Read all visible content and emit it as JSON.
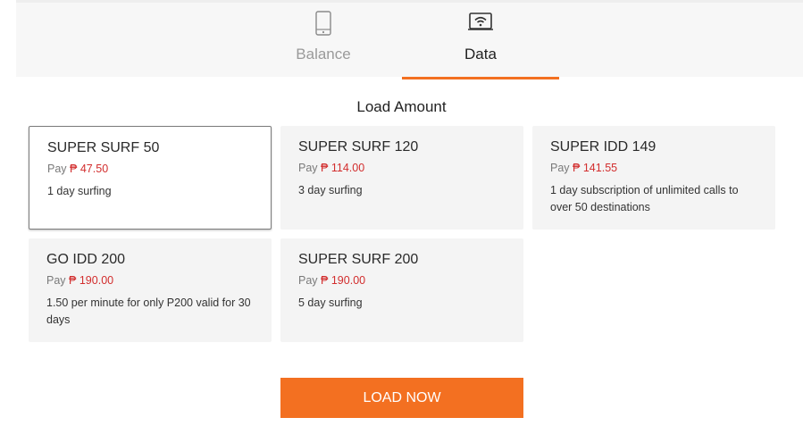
{
  "tabs": [
    {
      "label": "Balance",
      "icon": "mobile-phone-icon",
      "active": false
    },
    {
      "label": "Data",
      "icon": "wifi-device-icon",
      "active": true
    }
  ],
  "section_title": "Load Amount",
  "pay_label": "Pay",
  "currency_symbol": "₱",
  "offers": [
    {
      "name": "SUPER SURF 50",
      "price": "47.50",
      "description": "1 day surfing",
      "selected": true
    },
    {
      "name": "SUPER SURF 120",
      "price": "114.00",
      "description": "3 day surfing",
      "selected": false
    },
    {
      "name": "SUPER IDD 149",
      "price": "141.55",
      "description": "1 day subscription of unlimited calls to over 50 destinations",
      "selected": false
    },
    {
      "name": "GO IDD 200",
      "price": "190.00",
      "description": "1.50 per minute for only P200 valid for 30 days",
      "selected": false
    },
    {
      "name": "SUPER SURF 200",
      "price": "190.00",
      "description": "5 day surfing",
      "selected": false
    }
  ],
  "load_button_label": "LOAD NOW",
  "colors": {
    "accent": "#f37021",
    "price": "#d22d2d",
    "card_bg": "#f4f4f4"
  }
}
